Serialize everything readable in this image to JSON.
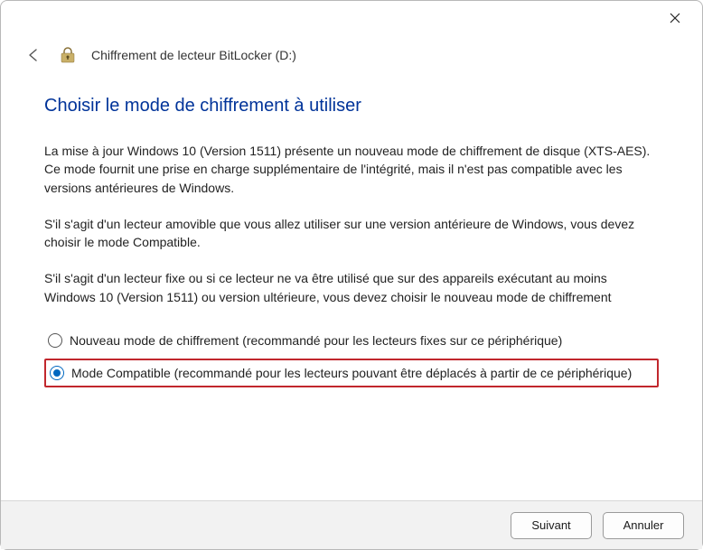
{
  "window": {
    "title": "Chiffrement de lecteur BitLocker (D:)"
  },
  "heading": "Choisir le mode de chiffrement à utiliser",
  "para1": "La mise à jour Windows 10 (Version 1511) présente un nouveau mode de chiffrement de disque (XTS-AES). Ce mode fournit une prise en charge supplémentaire de l'intégrité, mais il n'est pas compatible avec les versions antérieures de Windows.",
  "para2": "S'il s'agit d'un lecteur amovible que vous allez utiliser sur une version antérieure de Windows, vous devez choisir le mode Compatible.",
  "para3": "S'il s'agit d'un lecteur fixe ou si ce lecteur ne va être utilisé que sur des appareils exécutant au moins Windows 10 (Version 1511) ou version ultérieure, vous devez choisir le nouveau mode de chiffrement",
  "options": {
    "new_mode": "Nouveau mode de chiffrement (recommandé pour les lecteurs fixes sur ce périphérique)",
    "compat_mode": "Mode Compatible (recommandé pour les lecteurs pouvant être déplacés à partir de ce périphérique)"
  },
  "selected": "compat_mode",
  "buttons": {
    "next": "Suivant",
    "cancel": "Annuler"
  }
}
